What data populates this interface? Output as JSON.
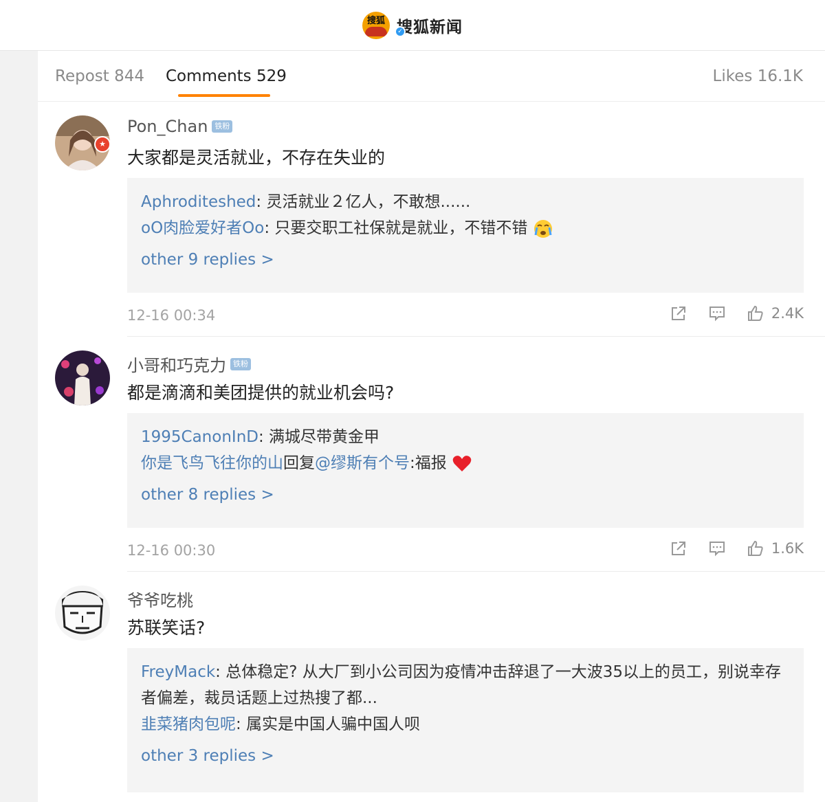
{
  "app": {
    "brand_name": "搜狐新闻",
    "logo_text": "搜狐"
  },
  "tabs": {
    "repost": "Repost 844",
    "comments": "Comments 529",
    "likes": "Likes 16.1K"
  },
  "colors": {
    "accent": "#ff8200",
    "link": "#4e7fb5",
    "badge": "#9cbfe0"
  },
  "comments": [
    {
      "username": "Pon_Chan",
      "badge": "铁粉",
      "text": "大家都是灵活就业，不存在失业的",
      "replies": [
        {
          "user": "Aphroditeshed",
          "text": ": 灵活就业２亿人，不敢想......"
        },
        {
          "user": "oO肉脸爱好者Oo",
          "text": ": 只要交职工社保就是就业，不错不错",
          "emoji": "crying-face-icon"
        }
      ],
      "more": "other 9 replies >",
      "time": "12-16 00:34",
      "likes": "2.4K"
    },
    {
      "username": "小哥和巧克力",
      "badge": "铁粉",
      "text": "都是滴滴和美团提供的就业机会吗?",
      "replies": [
        {
          "user": "1995CanonInD",
          "text": ": 满城尽带黄金甲"
        },
        {
          "user": "你是飞鸟飞往你的山",
          "text": "回复",
          "mention": "@缪斯有个号",
          "text2": ":福报",
          "emoji": "red-heart-icon"
        }
      ],
      "more": "other 8 replies >",
      "time": "12-16 00:30",
      "likes": "1.6K"
    },
    {
      "username": "爷爷吃桃",
      "text": "苏联笑话?",
      "replies": [
        {
          "user": "FreyMack",
          "text": ": 总体稳定? 从大厂到小公司因为疫情冲击辞退了一大波35以上的员工，别说幸存者偏差，裁员话题上过热搜了都..."
        },
        {
          "user": "韭菜猪肉包呢",
          "text": ": 属实是中国人骗中国人呗"
        }
      ],
      "more": "other 3 replies >"
    }
  ]
}
